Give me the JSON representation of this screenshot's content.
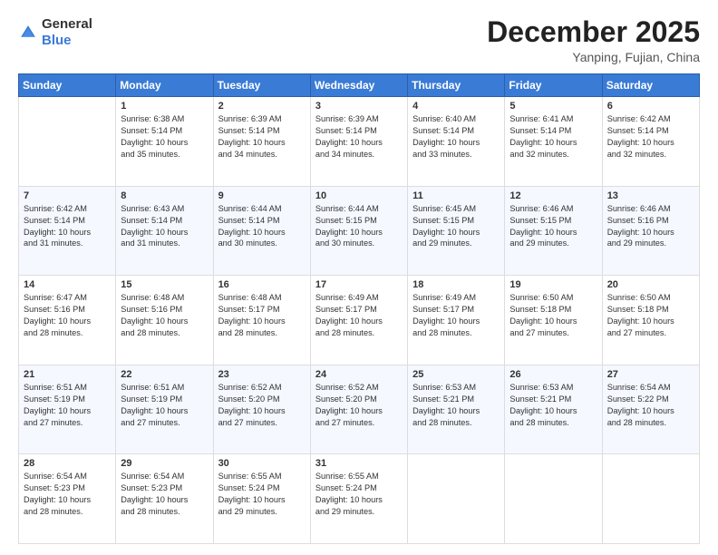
{
  "logo": {
    "general": "General",
    "blue": "Blue"
  },
  "header": {
    "month": "December 2025",
    "location": "Yanping, Fujian, China"
  },
  "weekdays": [
    "Sunday",
    "Monday",
    "Tuesday",
    "Wednesday",
    "Thursday",
    "Friday",
    "Saturday"
  ],
  "weeks": [
    [
      {
        "day": "",
        "info": ""
      },
      {
        "day": "1",
        "info": "Sunrise: 6:38 AM\nSunset: 5:14 PM\nDaylight: 10 hours\nand 35 minutes."
      },
      {
        "day": "2",
        "info": "Sunrise: 6:39 AM\nSunset: 5:14 PM\nDaylight: 10 hours\nand 34 minutes."
      },
      {
        "day": "3",
        "info": "Sunrise: 6:39 AM\nSunset: 5:14 PM\nDaylight: 10 hours\nand 34 minutes."
      },
      {
        "day": "4",
        "info": "Sunrise: 6:40 AM\nSunset: 5:14 PM\nDaylight: 10 hours\nand 33 minutes."
      },
      {
        "day": "5",
        "info": "Sunrise: 6:41 AM\nSunset: 5:14 PM\nDaylight: 10 hours\nand 32 minutes."
      },
      {
        "day": "6",
        "info": "Sunrise: 6:42 AM\nSunset: 5:14 PM\nDaylight: 10 hours\nand 32 minutes."
      }
    ],
    [
      {
        "day": "7",
        "info": "Sunrise: 6:42 AM\nSunset: 5:14 PM\nDaylight: 10 hours\nand 31 minutes."
      },
      {
        "day": "8",
        "info": "Sunrise: 6:43 AM\nSunset: 5:14 PM\nDaylight: 10 hours\nand 31 minutes."
      },
      {
        "day": "9",
        "info": "Sunrise: 6:44 AM\nSunset: 5:14 PM\nDaylight: 10 hours\nand 30 minutes."
      },
      {
        "day": "10",
        "info": "Sunrise: 6:44 AM\nSunset: 5:15 PM\nDaylight: 10 hours\nand 30 minutes."
      },
      {
        "day": "11",
        "info": "Sunrise: 6:45 AM\nSunset: 5:15 PM\nDaylight: 10 hours\nand 29 minutes."
      },
      {
        "day": "12",
        "info": "Sunrise: 6:46 AM\nSunset: 5:15 PM\nDaylight: 10 hours\nand 29 minutes."
      },
      {
        "day": "13",
        "info": "Sunrise: 6:46 AM\nSunset: 5:16 PM\nDaylight: 10 hours\nand 29 minutes."
      }
    ],
    [
      {
        "day": "14",
        "info": "Sunrise: 6:47 AM\nSunset: 5:16 PM\nDaylight: 10 hours\nand 28 minutes."
      },
      {
        "day": "15",
        "info": "Sunrise: 6:48 AM\nSunset: 5:16 PM\nDaylight: 10 hours\nand 28 minutes."
      },
      {
        "day": "16",
        "info": "Sunrise: 6:48 AM\nSunset: 5:17 PM\nDaylight: 10 hours\nand 28 minutes."
      },
      {
        "day": "17",
        "info": "Sunrise: 6:49 AM\nSunset: 5:17 PM\nDaylight: 10 hours\nand 28 minutes."
      },
      {
        "day": "18",
        "info": "Sunrise: 6:49 AM\nSunset: 5:17 PM\nDaylight: 10 hours\nand 28 minutes."
      },
      {
        "day": "19",
        "info": "Sunrise: 6:50 AM\nSunset: 5:18 PM\nDaylight: 10 hours\nand 27 minutes."
      },
      {
        "day": "20",
        "info": "Sunrise: 6:50 AM\nSunset: 5:18 PM\nDaylight: 10 hours\nand 27 minutes."
      }
    ],
    [
      {
        "day": "21",
        "info": "Sunrise: 6:51 AM\nSunset: 5:19 PM\nDaylight: 10 hours\nand 27 minutes."
      },
      {
        "day": "22",
        "info": "Sunrise: 6:51 AM\nSunset: 5:19 PM\nDaylight: 10 hours\nand 27 minutes."
      },
      {
        "day": "23",
        "info": "Sunrise: 6:52 AM\nSunset: 5:20 PM\nDaylight: 10 hours\nand 27 minutes."
      },
      {
        "day": "24",
        "info": "Sunrise: 6:52 AM\nSunset: 5:20 PM\nDaylight: 10 hours\nand 27 minutes."
      },
      {
        "day": "25",
        "info": "Sunrise: 6:53 AM\nSunset: 5:21 PM\nDaylight: 10 hours\nand 28 minutes."
      },
      {
        "day": "26",
        "info": "Sunrise: 6:53 AM\nSunset: 5:21 PM\nDaylight: 10 hours\nand 28 minutes."
      },
      {
        "day": "27",
        "info": "Sunrise: 6:54 AM\nSunset: 5:22 PM\nDaylight: 10 hours\nand 28 minutes."
      }
    ],
    [
      {
        "day": "28",
        "info": "Sunrise: 6:54 AM\nSunset: 5:23 PM\nDaylight: 10 hours\nand 28 minutes."
      },
      {
        "day": "29",
        "info": "Sunrise: 6:54 AM\nSunset: 5:23 PM\nDaylight: 10 hours\nand 28 minutes."
      },
      {
        "day": "30",
        "info": "Sunrise: 6:55 AM\nSunset: 5:24 PM\nDaylight: 10 hours\nand 29 minutes."
      },
      {
        "day": "31",
        "info": "Sunrise: 6:55 AM\nSunset: 5:24 PM\nDaylight: 10 hours\nand 29 minutes."
      },
      {
        "day": "",
        "info": ""
      },
      {
        "day": "",
        "info": ""
      },
      {
        "day": "",
        "info": ""
      }
    ]
  ]
}
